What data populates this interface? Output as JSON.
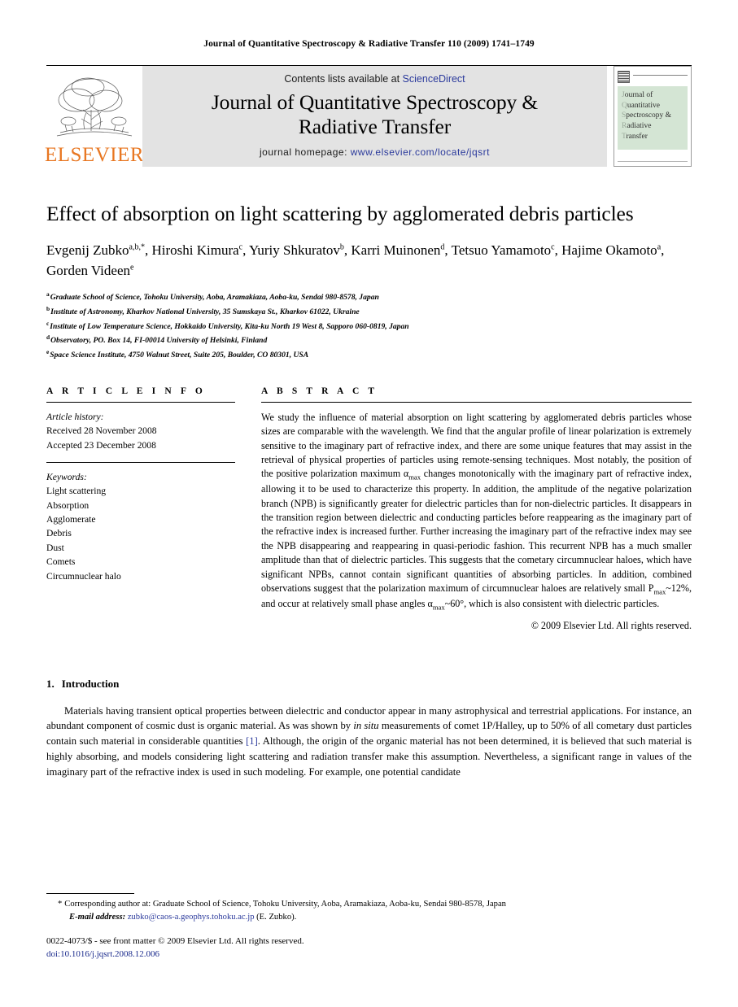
{
  "running_head": "Journal of Quantitative Spectroscopy & Radiative Transfer 110 (2009) 1741–1749",
  "banner": {
    "publisher_name": "ELSEVIER",
    "publisher_color": "#E87722",
    "contents_prefix": "Contents lists available at ",
    "contents_link": "ScienceDirect",
    "journal_title_line1": "Journal of Quantitative Spectroscopy &",
    "journal_title_line2": "Radiative Transfer",
    "homepage_prefix": "journal homepage: ",
    "homepage_link": "www.elsevier.com/locate/jqsrt",
    "link_color": "#2b3a9c",
    "cover": {
      "line1": "ournal of",
      "line2": "uantitative",
      "line3": "pectroscopy &",
      "line4": "adiative",
      "line5": "ransfer",
      "cap1": "J",
      "cap2": "Q",
      "cap3": "S",
      "cap4": "R",
      "cap5": "T"
    }
  },
  "article": {
    "title": "Effect of absorption on light scattering by agglomerated debris particles",
    "authors": [
      {
        "name": "Evgenij Zubko",
        "marks": "a,b,*"
      },
      {
        "name": "Hiroshi Kimura",
        "marks": "c"
      },
      {
        "name": "Yuriy Shkuratov",
        "marks": "b"
      },
      {
        "name": "Karri Muinonen",
        "marks": "d"
      },
      {
        "name": "Tetsuo Yamamoto",
        "marks": "c"
      },
      {
        "name": "Hajime Okamoto",
        "marks": "a"
      },
      {
        "name": "Gorden Videen",
        "marks": "e"
      }
    ],
    "affiliations": [
      {
        "mark": "a",
        "text": "Graduate School of Science, Tohoku University, Aoba, Aramakiaza, Aoba-ku, Sendai 980-8578, Japan"
      },
      {
        "mark": "b",
        "text": "Institute of Astronomy, Kharkov National University, 35 Sumskaya St., Kharkov 61022, Ukraine"
      },
      {
        "mark": "c",
        "text": "Institute of Low Temperature Science, Hokkaido University, Kita-ku North 19 West 8, Sapporo 060-0819, Japan"
      },
      {
        "mark": "d",
        "text": "Observatory, PO. Box 14, FI-00014 University of Helsinki, Finland"
      },
      {
        "mark": "e",
        "text": "Space Science Institute, 4750 Walnut Street, Suite 205, Boulder, CO 80301, USA"
      }
    ]
  },
  "article_info": {
    "heading": "A R T I C L E   I N F O",
    "history_label": "Article history:",
    "received": "Received 28 November 2008",
    "accepted": "Accepted 23 December 2008",
    "keywords_label": "Keywords:",
    "keywords": [
      "Light scattering",
      "Absorption",
      "Agglomerate",
      "Debris",
      "Dust",
      "Comets",
      "Circumnuclear halo"
    ]
  },
  "abstract": {
    "heading": "A B S T R A C T",
    "part1": "We study the influence of material absorption on light scattering by agglomerated debris particles whose sizes are comparable with the wavelength. We find that the angular profile of linear polarization is extremely sensitive to the imaginary part of refractive index, and there are some unique features that may assist in the retrieval of physical properties of particles using remote-sensing techniques. Most notably, the position of the positive polarization maximum ",
    "sym1": "α",
    "sub1": "max",
    "part2": " changes monotonically with the imaginary part of refractive index, allowing it to be used to characterize this property. In addition, the amplitude of the negative polarization branch (NPB) is significantly greater for dielectric particles than for non-dielectric particles. It disappears in the transition region between dielectric and conducting particles before reappearing as the imaginary part of the refractive index is increased further. Further increasing the imaginary part of the refractive index may see the NPB disappearing and reappearing in quasi-periodic fashion. This recurrent NPB has a much smaller amplitude than that of dielectric particles. This suggests that the cometary circumnuclear haloes, which have significant NPBs, cannot contain significant quantities of absorbing particles. In addition, combined observations suggest that the polarization maximum of circumnuclear haloes are relatively small P",
    "sub2": "max",
    "part3": "~12%, and occur at relatively small phase angles ",
    "sym2": "α",
    "sub3": "max",
    "part4": "~60°, which is also consistent with dielectric particles.",
    "copyright": "© 2009 Elsevier Ltd. All rights reserved."
  },
  "body": {
    "section_number": "1.",
    "section_title": "Introduction",
    "paragraph_a": "Materials having transient optical properties between dielectric and conductor appear in many astrophysical and terrestrial applications. For instance, an abundant component of cosmic dust is organic material. As was shown by ",
    "paragraph_a_italic": "in situ",
    "paragraph_b": " measurements of comet 1P/Halley, up to 50% of all cometary dust particles contain such material in considerable quantities ",
    "citation": "[1]",
    "paragraph_c": ". Although, the origin of the organic material has not been determined, it is believed that such material is highly absorbing, and models considering light scattering and radiation transfer make this assumption. Nevertheless, a significant range in values of the imaginary part of the refractive index is used in such modeling. For example, one potential candidate"
  },
  "footnotes": {
    "corresponding_star": "*",
    "corresponding_text": "Corresponding author at: Graduate School of Science, Tohoku University, Aoba, Aramakiaza, Aoba-ku, Sendai 980-8578, Japan",
    "email_label": "E-mail address:",
    "email_address": "zubko@caos-a.geophys.tohoku.ac.jp",
    "email_owner": "(E. Zubko).",
    "issn_line": "0022-4073/$ - see front matter © 2009 Elsevier Ltd. All rights reserved.",
    "doi_line": "doi:10.1016/j.jqsrt.2008.12.006"
  }
}
